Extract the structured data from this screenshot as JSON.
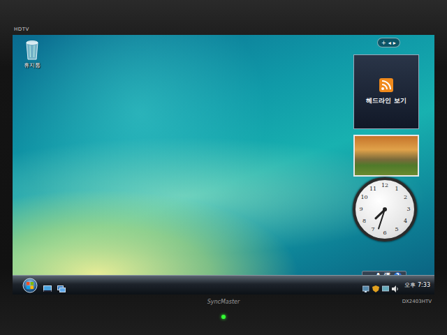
{
  "monitor": {
    "label_top": "HDTV",
    "brand": "SyncMaster",
    "model": "DX2403HTV",
    "power_on": true
  },
  "desktop": {
    "icons": [
      {
        "label": "휴지통"
      }
    ]
  },
  "sidebar": {
    "controls": [
      "+",
      "◂",
      "▸"
    ],
    "headlines": {
      "title": "헤드라인 보기"
    },
    "clock": {
      "numbers": [
        "12",
        "1",
        "2",
        "3",
        "4",
        "5",
        "6",
        "7",
        "8",
        "9",
        "10",
        "11"
      ],
      "hour": 7,
      "minute": 33
    }
  },
  "language_bar": {
    "items": [
      "A",
      "漢",
      "?"
    ]
  },
  "taskbar": {
    "clock": "오후 7:33"
  }
}
